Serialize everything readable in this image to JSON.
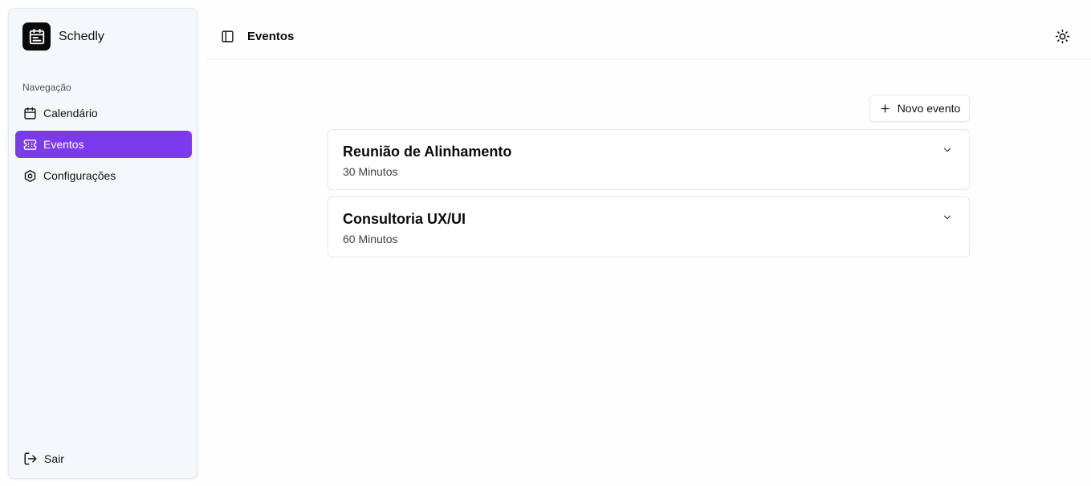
{
  "sidebar": {
    "brand_name": "Schedly",
    "nav_label": "Navegação",
    "items": [
      {
        "label": "Calendário",
        "icon": "calendar-icon",
        "active": false
      },
      {
        "label": "Eventos",
        "icon": "ticket-icon",
        "active": true
      },
      {
        "label": "Configurações",
        "icon": "settings-icon",
        "active": false
      }
    ],
    "logout_label": "Sair"
  },
  "header": {
    "title": "Eventos",
    "toggle_icon": "sidebar-toggle-icon",
    "theme_icon": "sun-icon"
  },
  "main": {
    "new_event_label": "Novo evento",
    "events": [
      {
        "title": "Reunião de Alinhamento",
        "duration": "30 Minutos"
      },
      {
        "title": "Consultoria UX/UI",
        "duration": "60 Minutos"
      }
    ]
  },
  "colors": {
    "accent": "#7c3aed",
    "sidebar_bg": "#f5f8fb",
    "border": "#e5e7eb"
  }
}
